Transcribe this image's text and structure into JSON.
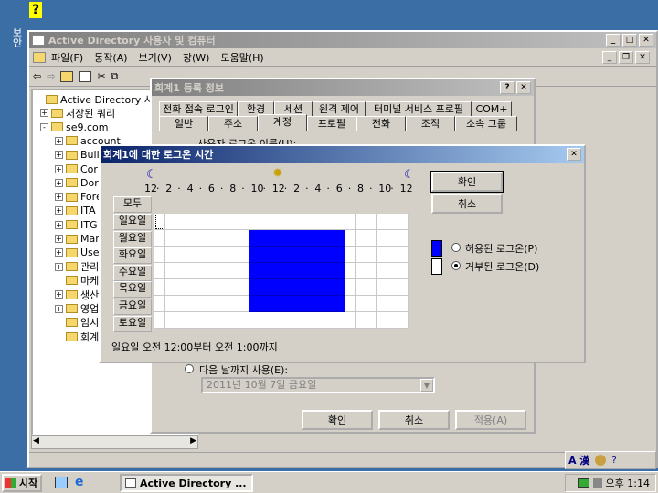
{
  "desktop": {
    "icon_label": "보안"
  },
  "mmc": {
    "title": "Active Directory 사용자 및 컴퓨터",
    "menu": [
      "파일(F)",
      "동작(A)",
      "보기(V)",
      "창(W)",
      "도움말(H)"
    ],
    "tree": [
      {
        "label": "Active Directory 사용자",
        "exp": ""
      },
      {
        "label": "저장된 쿼리",
        "exp": "+"
      },
      {
        "label": "se9.com",
        "exp": "-"
      },
      {
        "label": "account",
        "exp": "+"
      },
      {
        "label": "Buil",
        "exp": "+"
      },
      {
        "label": "Cor",
        "exp": "+"
      },
      {
        "label": "Dor",
        "exp": "+"
      },
      {
        "label": "Fore",
        "exp": "+"
      },
      {
        "label": "ITA",
        "exp": "+"
      },
      {
        "label": "ITG",
        "exp": "+"
      },
      {
        "label": "Mar",
        "exp": "+"
      },
      {
        "label": "Use",
        "exp": "+"
      },
      {
        "label": "관리",
        "exp": "+"
      },
      {
        "label": "마케",
        "exp": ""
      },
      {
        "label": "생산",
        "exp": "+"
      },
      {
        "label": "영업",
        "exp": "+"
      },
      {
        "label": "임시",
        "exp": ""
      },
      {
        "label": "회계",
        "exp": ""
      }
    ]
  },
  "props": {
    "title": "회계1 등록 정보",
    "tabs_row1": [
      "전화 접속 로그인",
      "환경",
      "세션",
      "원격 제어",
      "터미널 서비스 프로필",
      "COM+"
    ],
    "tabs_row2": [
      "일반",
      "주소",
      "계정",
      "프로필",
      "전화",
      "조직",
      "소속 그룹"
    ],
    "logon_name_label": "사용자 로그온 이름(U):",
    "expire_label": "다음 날까지 사용(E):",
    "expire_date": "2011년 10월  7일 금요일",
    "ok": "확인",
    "cancel": "취소",
    "apply": "적용(A)"
  },
  "logon": {
    "title": "회계1에 대한 로그온 시간",
    "hours": [
      "12",
      "2",
      "4",
      "6",
      "8",
      "10",
      "12",
      "2",
      "4",
      "6",
      "8",
      "10",
      "12"
    ],
    "all": "모두",
    "days": [
      "일요일",
      "월요일",
      "화요일",
      "수요일",
      "목요일",
      "금요일",
      "토요일"
    ],
    "ok": "확인",
    "cancel": "취소",
    "permitted": "허용된 로그온(P)",
    "denied": "거부된 로그온(D)",
    "status": "일요일 오전 12:00부터 오전 1:00까지",
    "permitted_color": "#0000ff",
    "grid": {
      "permitted_days": [
        "월요일",
        "화요일",
        "수요일",
        "목요일",
        "금요일"
      ],
      "permitted_from_hour": 9,
      "permitted_to_hour": 18
    },
    "selected": "denied"
  },
  "taskbar": {
    "start": "시작",
    "task": "Active Directory ...",
    "ime": "A 漢",
    "time": "오후 1:14"
  }
}
